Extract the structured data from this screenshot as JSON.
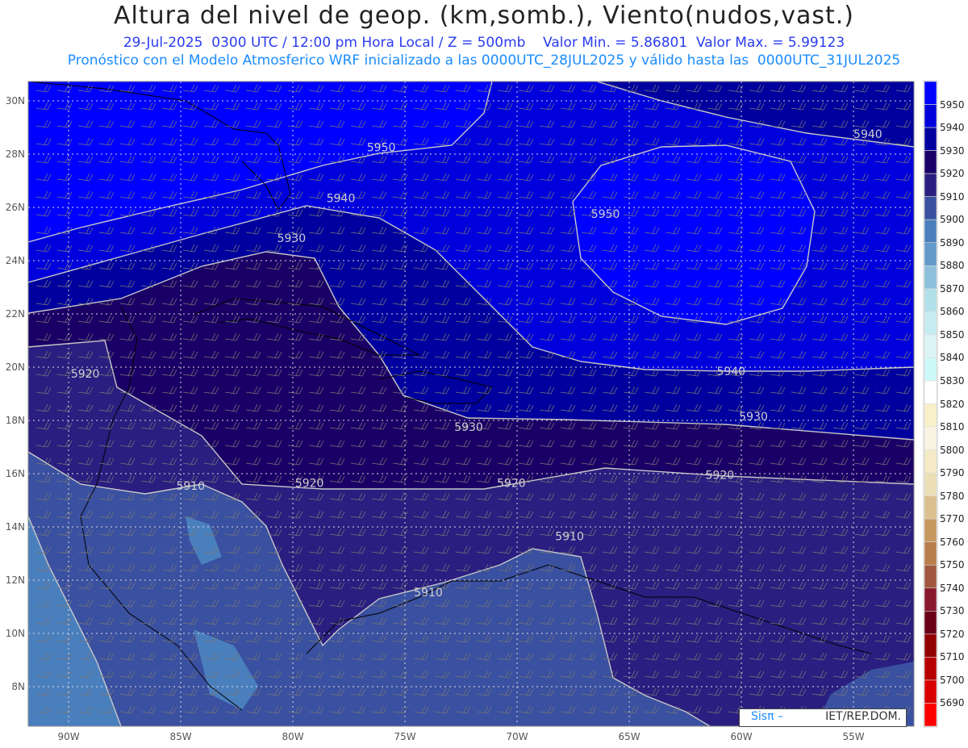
{
  "header": {
    "title": "Altura del nivel de geop. (km,somb.), Viento(nudos,vast.)",
    "subtitle": "29-Jul-2025  0300 UTC / 12:00 pm Hora Local / Z = 500mb    Valor Min. = 5.86801  Valor Max. = 5.99123",
    "info": "Pronóstico con el Modelo Atmosferico WRF inicializado a las 0000UTC_28JUL2025 y válido hasta las  0000UTC_31JUL2025"
  },
  "map": {
    "lon_ticks": [
      {
        "lon": -90,
        "label": "90W"
      },
      {
        "lon": -85,
        "label": "85W"
      },
      {
        "lon": -80,
        "label": "80W"
      },
      {
        "lon": -75,
        "label": "75W"
      },
      {
        "lon": -70,
        "label": "70W"
      },
      {
        "lon": -65,
        "label": "65W"
      },
      {
        "lon": -60,
        "label": "60W"
      },
      {
        "lon": -55,
        "label": "55W"
      }
    ],
    "lat_ticks": [
      {
        "lat": 30,
        "label": "30N"
      },
      {
        "lat": 28,
        "label": "28N"
      },
      {
        "lat": 26,
        "label": "26N"
      },
      {
        "lat": 24,
        "label": "24N"
      },
      {
        "lat": 22,
        "label": "22N"
      },
      {
        "lat": 20,
        "label": "20N"
      },
      {
        "lat": 18,
        "label": "18N"
      },
      {
        "lat": 16,
        "label": "16N"
      },
      {
        "lat": 14,
        "label": "14N"
      },
      {
        "lat": 12,
        "label": "12N"
      },
      {
        "lat": 10,
        "label": "10N"
      },
      {
        "lat": 8,
        "label": "8N"
      }
    ],
    "contour_labels": [
      {
        "text": "5950",
        "lon": -76.7,
        "lat": 28.1
      },
      {
        "text": "5940",
        "lon": -78.5,
        "lat": 26.2
      },
      {
        "text": "5930",
        "lon": -80.7,
        "lat": 24.7
      },
      {
        "text": "5950",
        "lon": -66.7,
        "lat": 25.6
      },
      {
        "text": "5940",
        "lon": -55.0,
        "lat": 28.6
      },
      {
        "text": "5920",
        "lon": -89.9,
        "lat": 19.6
      },
      {
        "text": "5940",
        "lon": -61.1,
        "lat": 19.7
      },
      {
        "text": "5930",
        "lon": -72.8,
        "lat": 17.6
      },
      {
        "text": "5930",
        "lon": -60.1,
        "lat": 18.0
      },
      {
        "text": "5910",
        "lon": -85.2,
        "lat": 15.4
      },
      {
        "text": "5920",
        "lon": -79.9,
        "lat": 15.5
      },
      {
        "text": "5920",
        "lon": -70.9,
        "lat": 15.5
      },
      {
        "text": "5920",
        "lon": -61.6,
        "lat": 15.8
      },
      {
        "text": "5910",
        "lon": -68.3,
        "lat": 13.5
      },
      {
        "text": "5910",
        "lon": -74.6,
        "lat": 11.4
      }
    ]
  },
  "colorbar": {
    "labels": [
      "5950",
      "5940",
      "5930",
      "5920",
      "5910",
      "5900",
      "5890",
      "5880",
      "5870",
      "5860",
      "5850",
      "5840",
      "5830",
      "5820",
      "5810",
      "5800",
      "5790",
      "5780",
      "5770",
      "5760",
      "5750",
      "5740",
      "5730",
      "5720",
      "5710",
      "5700",
      "5690"
    ],
    "colors": [
      "#0000ff",
      "#0000dc",
      "#00009e",
      "#1a0066",
      "#2a1e80",
      "#3a50a0",
      "#4a7fbe",
      "#6199c9",
      "#8cc0dc",
      "#b2e0ea",
      "#c6ecf2",
      "#ddf4f7",
      "#cdf9f9",
      "#ffffff",
      "#f8f0c8",
      "#f9f4e2",
      "#f4ebc6",
      "#ecdfb6",
      "#dcbf8e",
      "#c6975f",
      "#b77d4b",
      "#a0573f",
      "#89182e",
      "#6a0018",
      "#920000",
      "#b80000",
      "#d90000",
      "#ff0000"
    ]
  },
  "logo": {
    "sis": "Sisπ –",
    "org": "IET/REP.DOM."
  }
}
